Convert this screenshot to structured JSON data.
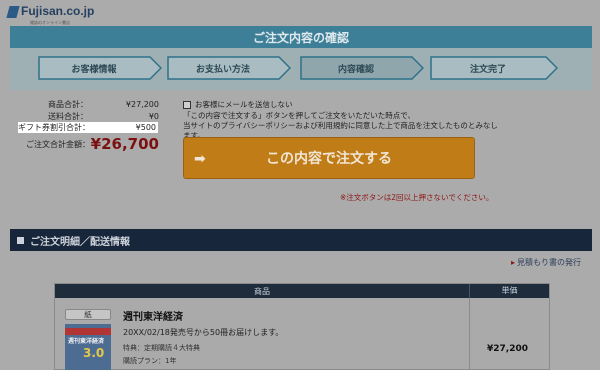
{
  "header": {
    "logo_text": "Fujisan.co.jp",
    "logo_sub": "雑誌のオンライン書店"
  },
  "page_title": "ご注文内容の確認",
  "steps": [
    {
      "label": "お客様情報",
      "active": false
    },
    {
      "label": "お支払い方法",
      "active": false
    },
    {
      "label": "内容確認",
      "active": true
    },
    {
      "label": "注文完了",
      "active": false
    }
  ],
  "summary": {
    "subtotal_label": "商品合計：",
    "subtotal_value": "¥27,200",
    "shipping_label": "送料合計：",
    "shipping_value": "¥0",
    "gift_label": "ギフト券割引合計：",
    "gift_value": "¥500",
    "total_label": "ご注文合計金額：",
    "total_value": "¥26,700"
  },
  "mail_opt": {
    "label": "お客様にメールを送信しない",
    "checked": false
  },
  "notice": {
    "line1": "「この内容で注文する」ボタンを押してご注文をいただいた時点で、",
    "line2": "当サイトのプライバシーポリシーおよび利用規約に同意した上で商品を注文したものとみなします。"
  },
  "order_button": {
    "label": "この内容で注文する"
  },
  "warning": "※注文ボタンは2回以上押さないでください。",
  "section": {
    "title": "ご注文明細／配送情報"
  },
  "receipt_link": "見積もり書の発行",
  "table": {
    "col_product": "商品",
    "col_price": "単価",
    "items": [
      {
        "tag": "紙",
        "thumb_title": "週刊東洋経済",
        "thumb_big": "3.0",
        "name": "週刊東洋経済",
        "desc": "20XX/02/18発売号から50冊お届けします。",
        "perk": "特典：定期購読４大特典",
        "plan": "購読プラン：1年",
        "price": "¥27,200"
      }
    ]
  },
  "colors": {
    "title_bar": "#3d7f96",
    "section_bar": "#17263a",
    "order_button": "#c07c16",
    "total": "#7a1010"
  }
}
